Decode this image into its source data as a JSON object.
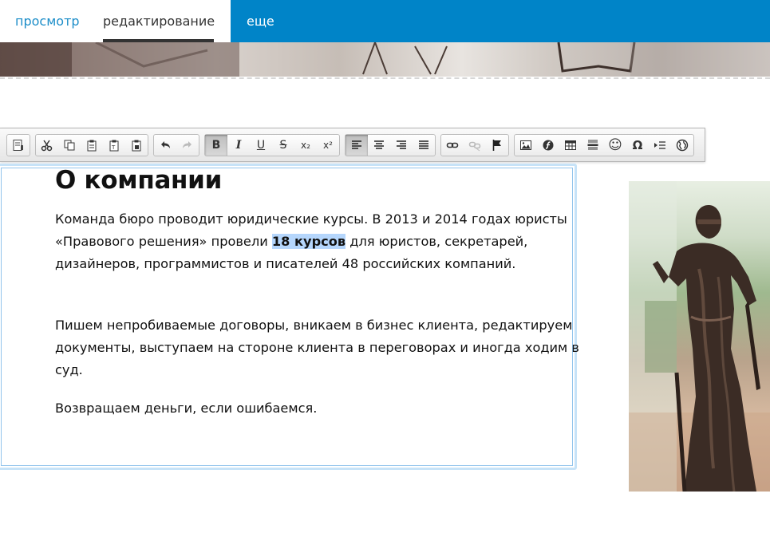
{
  "tabs": [
    {
      "label": "просмотр"
    },
    {
      "label": "редактирование"
    },
    {
      "label": "еще"
    }
  ],
  "toolbar": {
    "buttons": [
      {
        "icon": "source-icon"
      },
      {
        "icon": "cut-icon"
      },
      {
        "icon": "copy-icon"
      },
      {
        "icon": "paste-icon"
      },
      {
        "icon": "paste-text-icon"
      },
      {
        "icon": "paste-word-icon"
      },
      {
        "icon": "undo-icon"
      },
      {
        "icon": "redo-icon"
      },
      {
        "icon": "bold-icon",
        "label": "B"
      },
      {
        "icon": "italic-icon",
        "label": "I"
      },
      {
        "icon": "underline-icon",
        "label": "U"
      },
      {
        "icon": "strikethrough-icon",
        "label": "S"
      },
      {
        "icon": "subscript-icon",
        "label": "x₂"
      },
      {
        "icon": "superscript-icon",
        "label": "x²"
      },
      {
        "icon": "align-left-icon"
      },
      {
        "icon": "align-center-icon"
      },
      {
        "icon": "align-right-icon"
      },
      {
        "icon": "align-justify-icon"
      },
      {
        "icon": "link-icon"
      },
      {
        "icon": "unlink-icon"
      },
      {
        "icon": "anchor-flag-icon"
      },
      {
        "icon": "image-icon"
      },
      {
        "icon": "flash-icon"
      },
      {
        "icon": "table-icon"
      },
      {
        "icon": "horizontal-rule-icon"
      },
      {
        "icon": "smiley-icon",
        "label": "☺"
      },
      {
        "icon": "special-char-icon",
        "label": "Ω"
      },
      {
        "icon": "page-break-icon"
      },
      {
        "icon": "iframe-globe-icon"
      }
    ]
  },
  "content": {
    "heading": "О компании",
    "p1_before": "Команда бюро проводит юридические курсы. В 2013 и 2014 годах юристы «Правового решения» провели ",
    "p1_highlight": "18 курсов",
    "p1_after": " для юристов, секретарей, дизайнеров, программистов и писателей 48 российских компаний.",
    "p2": "Пишем непробиваемые договоры, вникаем в бизнес клиента, редактируем документы, выступаем на стороне клиента в переговорах и иногда ходим в суд.",
    "p3": "Возвращаем деньги, если ошибаемся."
  },
  "colors": {
    "tab_bar": "#0084c8",
    "active_tab_text": "#1d8ec9",
    "editor_border": "#c7e3f8",
    "selection": "#b5d6fc"
  }
}
